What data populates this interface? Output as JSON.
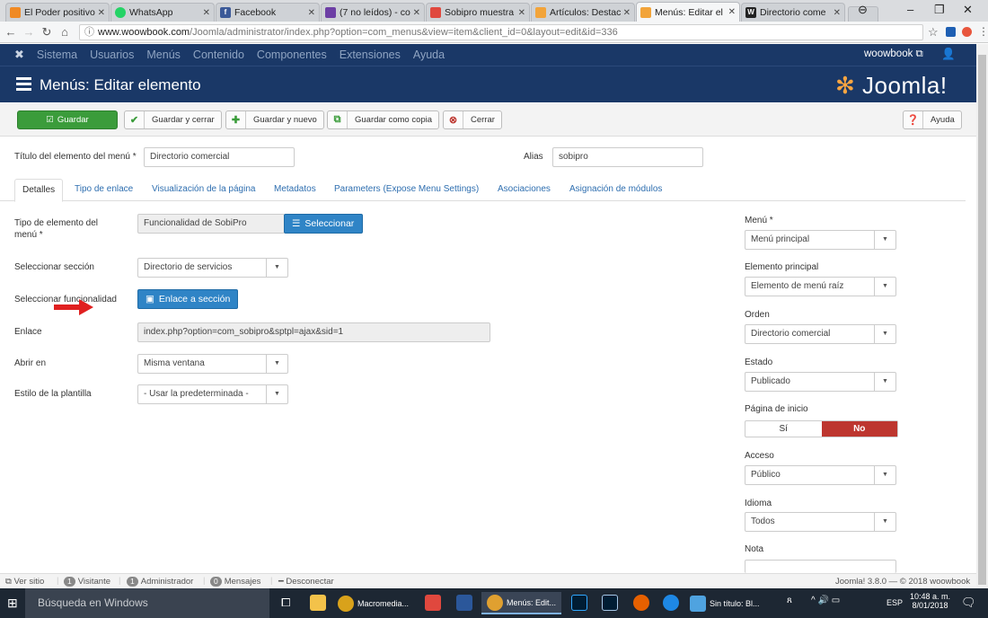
{
  "browser": {
    "tabs": [
      {
        "title": "El Poder positivo",
        "color": "#f08a24"
      },
      {
        "title": "WhatsApp",
        "color": "#25d366"
      },
      {
        "title": "Facebook",
        "color": "#3b5998"
      },
      {
        "title": "(7 no leídos) - co",
        "color": "#6d3fa5"
      },
      {
        "title": "Sobipro muestra",
        "color": "#e0483e"
      },
      {
        "title": "Artículos: Destac",
        "color": "#f2a43a"
      },
      {
        "title": "Menús: Editar el",
        "color": "#f2a43a",
        "active": true
      },
      {
        "title": "Directorio come",
        "color": "#222"
      }
    ],
    "url_host": "www.woowbook.com",
    "url_path": "/Joomla/administrator/index.php?option=com_menus&view=item&client_id=0&layout=edit&id=336"
  },
  "joomla_nav": {
    "items": [
      "Sistema",
      "Usuarios",
      "Menús",
      "Contenido",
      "Componentes",
      "Extensiones",
      "Ayuda"
    ],
    "site_link": "woowbook"
  },
  "header": {
    "title": "Menús: Editar elemento",
    "logo_text": "Joomla!"
  },
  "toolbar": {
    "save": "Guardar",
    "save_close": "Guardar y cerrar",
    "save_new": "Guardar y nuevo",
    "save_copy": "Guardar como copia",
    "close": "Cerrar",
    "help": "Ayuda"
  },
  "form": {
    "title_label": "Título del elemento del menú *",
    "title_value": "Directorio comercial",
    "alias_label": "Alias",
    "alias_value": "sobipro",
    "tabs": [
      "Detalles",
      "Tipo de enlace",
      "Visualización de la página",
      "Metadatos",
      "Parameters (Expose Menu Settings)",
      "Asociaciones",
      "Asignación de módulos"
    ],
    "type_label_1": "Tipo de elemento del",
    "type_label_2": "menú *",
    "type_value": "Funcionalidad de SobiPro",
    "select_button": "Seleccionar",
    "section_label": "Seleccionar sección",
    "section_value": "Directorio de servicios",
    "function_label": "Seleccionar funcionalidad",
    "function_button": "Enlace a sección",
    "link_label": "Enlace",
    "link_value": "index.php?option=com_sobipro&sptpl=ajax&sid=1",
    "open_label": "Abrir en",
    "open_value": "Misma ventana",
    "style_label": "Estilo de la plantilla",
    "style_value": "- Usar la predeterminada -"
  },
  "sidebar": {
    "menu_label": "Menú *",
    "menu_value": "Menú principal",
    "parent_label": "Elemento principal",
    "parent_value": "Elemento de menú raíz",
    "order_label": "Orden",
    "order_value": "Directorio comercial",
    "state_label": "Estado",
    "state_value": "Publicado",
    "home_label": "Página de inicio",
    "home_yes": "Sí",
    "home_no": "No",
    "access_label": "Acceso",
    "access_value": "Público",
    "lang_label": "Idioma",
    "lang_value": "Todos",
    "note_label": "Nota"
  },
  "status": {
    "view_site": "Ver sitio",
    "visitors_count": "1",
    "visitors": "Visitante",
    "admins_count": "1",
    "admins": "Administrador",
    "messages_count": "0",
    "messages": "Mensajes",
    "logout": "Desconectar",
    "version": "Joomla! 3.8.0 — © 2018 woowbook"
  },
  "taskbar": {
    "search": "Búsqueda en Windows",
    "apps": [
      "Macromedia...",
      "Menús: Edit...",
      "Sin título: Bl..."
    ],
    "lang": "ESP",
    "time": "10:48 a. m.",
    "date": "8/01/2018"
  },
  "colors": {
    "joomla_blue": "#1a3867",
    "save_green": "#3b9c3b",
    "select_blue": "#2f84c6",
    "no_red": "#bd362f",
    "arrow_red": "#e02020"
  }
}
